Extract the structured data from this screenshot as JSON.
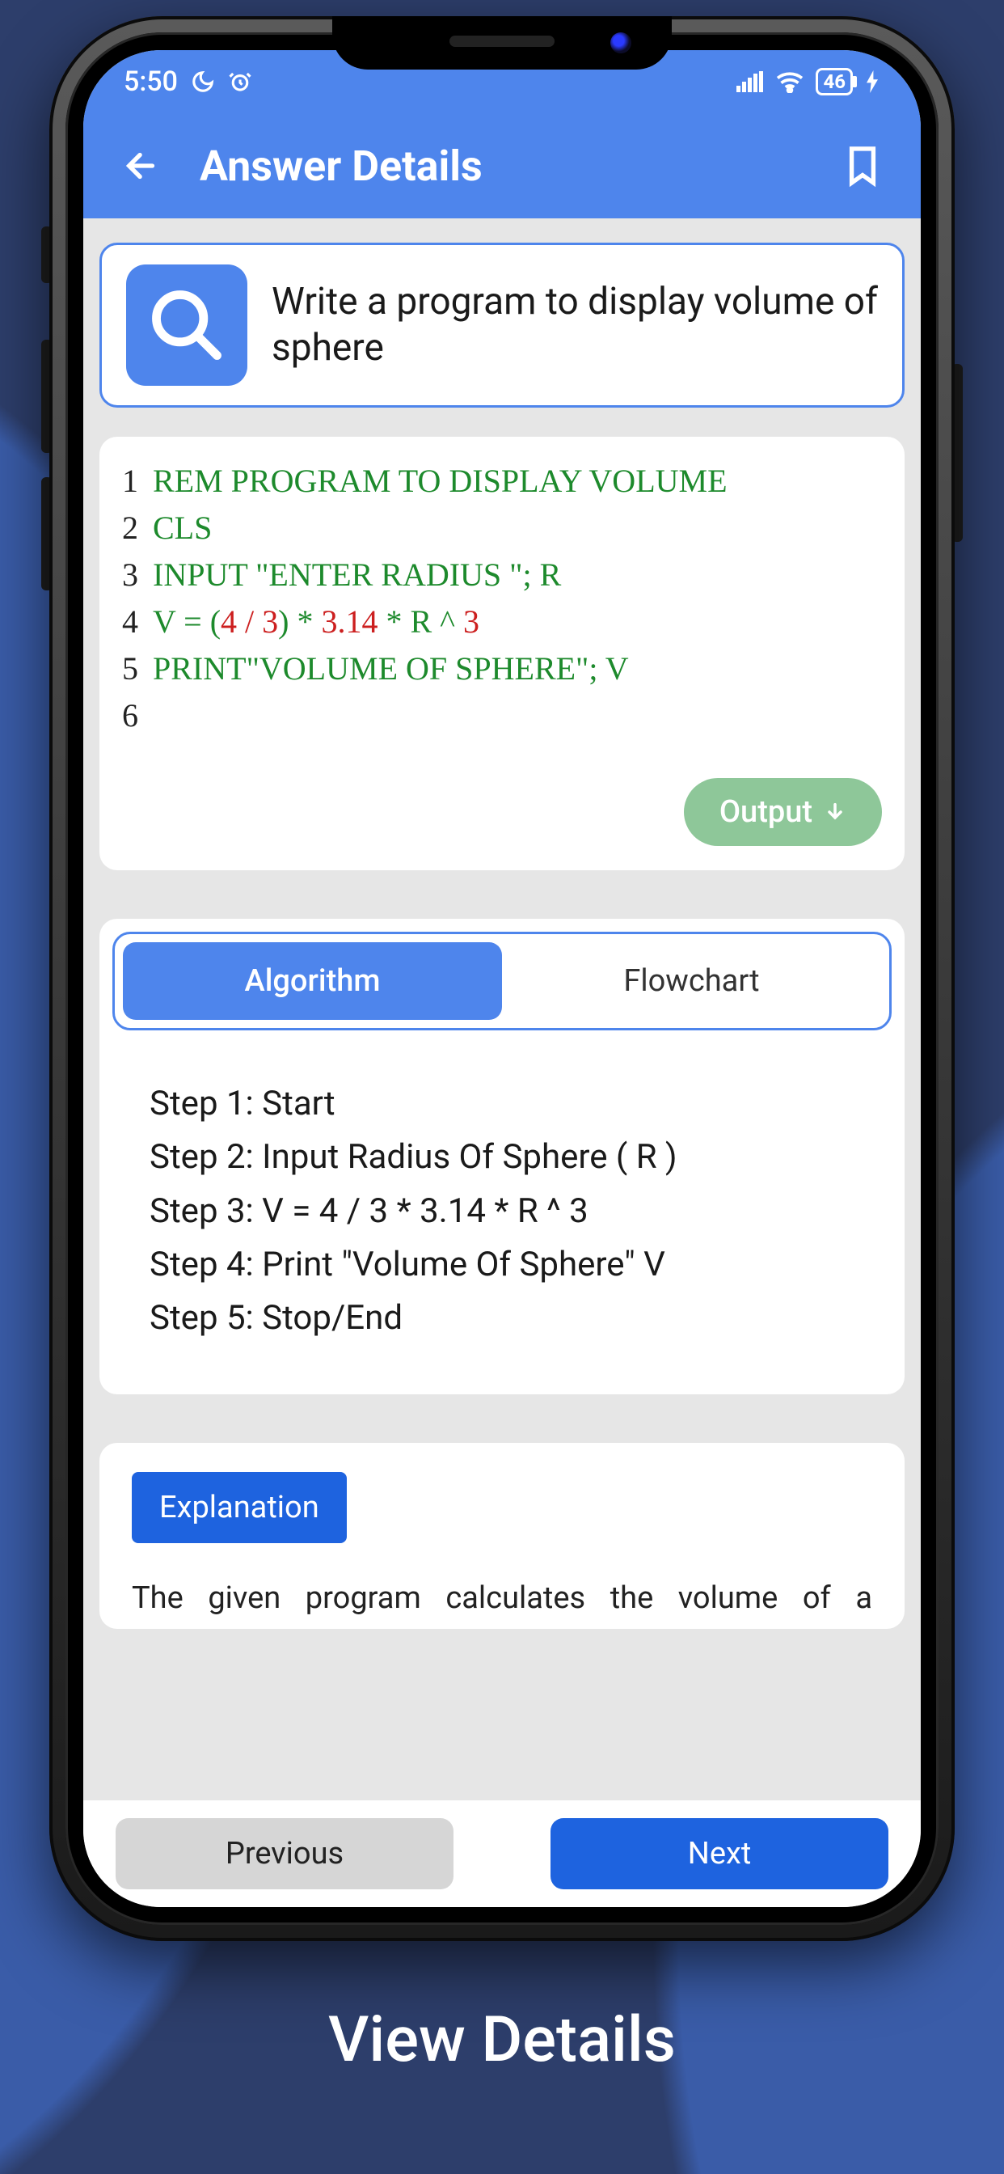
{
  "statusbar": {
    "time": "5:50",
    "battery": "46"
  },
  "header": {
    "title": "Answer Details"
  },
  "question": {
    "text": "Write a program to display volume of sphere"
  },
  "code_lines": [
    "1",
    "2",
    "3",
    "4",
    "5",
    "6"
  ],
  "code": {
    "l1_rem": "REM PROGRAM TO DISPLAY VOLUME",
    "l2": "CLS",
    "l3_input": "INPUT ",
    "l3_str": "\"ENTER RADIUS \"",
    "l3_tail": "; R",
    "l4_a": "V = (",
    "l4_num1": "4 / 3",
    "l4_b": ") * ",
    "l4_num2": "3.14",
    "l4_c": " * R ^ ",
    "l4_num3": "3",
    "l5_print": "PRINT",
    "l5_str": "\"VOLUME OF SPHERE\"",
    "l5_tail": "; V"
  },
  "output_button": "Output",
  "segments": {
    "algorithm": "Algorithm",
    "flowchart": "Flowchart"
  },
  "steps": [
    "Step 1: Start",
    "Step 2: Input Radius Of Sphere ( R )",
    "Step 3: V = 4 / 3 * 3.14  * R ^ 3",
    "Step 4: Print \"Volume Of Sphere\" V",
    "Step 5: Stop/End"
  ],
  "explanation": {
    "chip": "Explanation",
    "text": "The given program calculates the volume of a"
  },
  "footer": {
    "prev": "Previous",
    "next": "Next"
  },
  "caption": "View Details",
  "colors": {
    "primary": "#4e85ec",
    "accent": "#1e63df",
    "success": "#8ec799"
  }
}
